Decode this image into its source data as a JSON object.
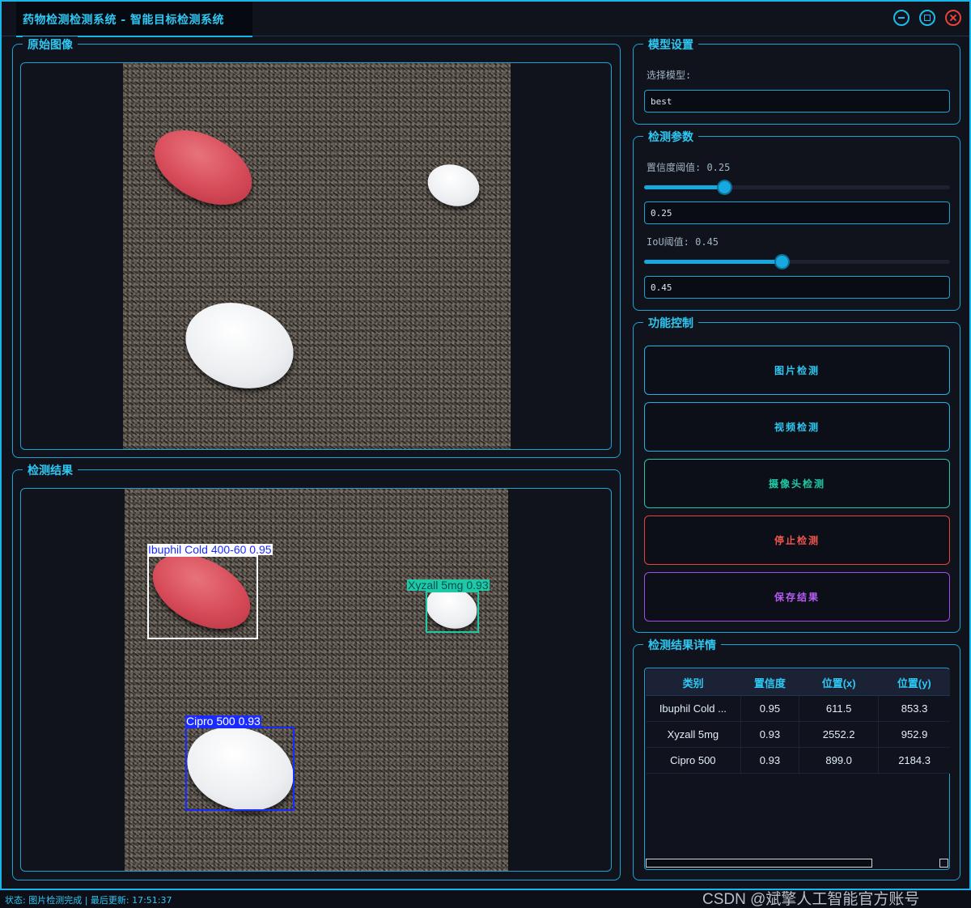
{
  "window": {
    "title": "药物检测检测系统 - 智能目标检测系统"
  },
  "original_panel": {
    "title": "原始图像"
  },
  "result_panel": {
    "title": "检测结果"
  },
  "detections": [
    {
      "label": "Ibuphil Cold 400-60 0.95",
      "color": "#ffffff"
    },
    {
      "label": "Xyzall 5mg 0.93",
      "color": "#1ec9a6"
    },
    {
      "label": "Cipro 500 0.93",
      "color": "#1a2bff"
    }
  ],
  "model_settings": {
    "title": "模型设置",
    "select_label": "选择模型:",
    "selected_model": "best"
  },
  "detect_params": {
    "title": "检测参数",
    "conf_label": "置信度阈值: 0.25",
    "conf_value": 0.25,
    "conf_input": "0.25",
    "iou_label": "IoU阈值: 0.45",
    "iou_value": 0.45,
    "iou_input": "0.45"
  },
  "controls": {
    "title": "功能控制",
    "image_detect": "图片检测",
    "video_detect": "视频检测",
    "camera_detect": "摄像头检测",
    "stop_detect": "停止检测",
    "save_result": "保存结果"
  },
  "results_table": {
    "title": "检测结果详情",
    "columns": [
      "类别",
      "置信度",
      "位置(x)",
      "位置(y)"
    ],
    "rows": [
      [
        "Ibuphil Cold ...",
        "0.95",
        "611.5",
        "853.3"
      ],
      [
        "Xyzall 5mg",
        "0.93",
        "2552.2",
        "952.9"
      ],
      [
        "Cipro 500",
        "0.93",
        "899.0",
        "2184.3"
      ]
    ]
  },
  "status": {
    "text": "状态: 图片检测完成 | 最后更新: 17:51:37"
  },
  "watermark": "CSDN @斌擎人工智能官方账号",
  "colors": {
    "accent": "#19b5e8",
    "camera": "#1ec9a6",
    "stop": "#e5433b",
    "save": "#a34ce8"
  }
}
